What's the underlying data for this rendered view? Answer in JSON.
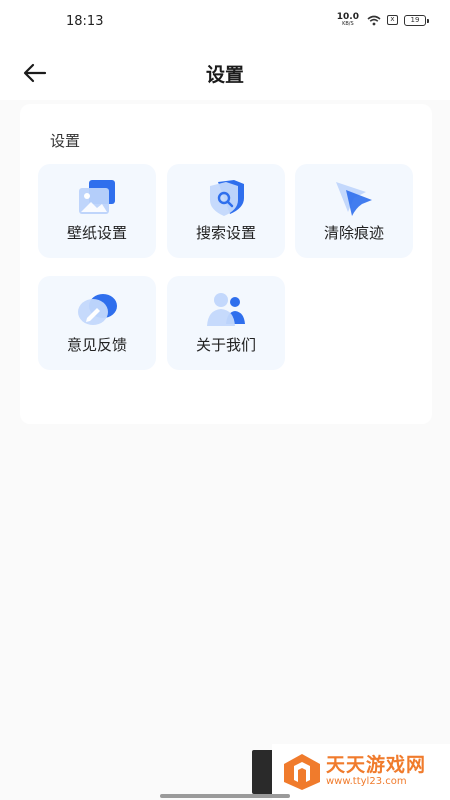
{
  "status_bar": {
    "time": "18:13",
    "net_speed_value": "10.0",
    "net_speed_unit": "KB/S",
    "sim_label": "x",
    "battery": "19",
    "icons": [
      "wifi-icon",
      "sim-icon",
      "battery-icon"
    ]
  },
  "header": {
    "title": "设置",
    "back_icon": "arrow-left-icon"
  },
  "settings": {
    "section_title": "设置",
    "items": [
      {
        "label": "壁纸设置",
        "icon": "wallpaper-icon"
      },
      {
        "label": "搜索设置",
        "icon": "search-shield-icon"
      },
      {
        "label": "清除痕迹",
        "icon": "clear-cursor-icon"
      },
      {
        "label": "意见反馈",
        "icon": "feedback-pencil-icon"
      },
      {
        "label": "关于我们",
        "icon": "people-icon"
      }
    ]
  },
  "watermark": {
    "title": "天天游戏网",
    "url": "www.ttyl23.com"
  },
  "colors": {
    "accent": "#2f6fed",
    "tile_bg": "#f3f8fe",
    "page_bg": "#fafafa"
  }
}
